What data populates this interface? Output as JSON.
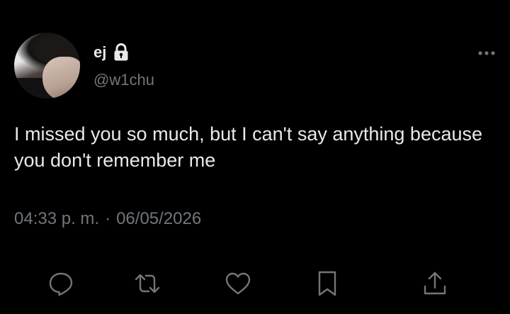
{
  "author": {
    "display_name": "ej",
    "handle": "@w1chu",
    "protected": true
  },
  "tweet": {
    "text": "I missed you so much, but I can't say anything because you don't remember me",
    "time": "04:33 p. m.",
    "separator": "·",
    "date": "06/05/2026"
  },
  "icons": {
    "lock": "lock-icon",
    "more": "more-horizontal-icon",
    "reply": "reply-icon",
    "retweet": "retweet-icon",
    "like": "heart-icon",
    "bookmark": "bookmark-icon",
    "share": "share-icon"
  },
  "colors": {
    "background": "#000000",
    "primary_text": "#e7e9ea",
    "secondary_text": "#71767b"
  }
}
